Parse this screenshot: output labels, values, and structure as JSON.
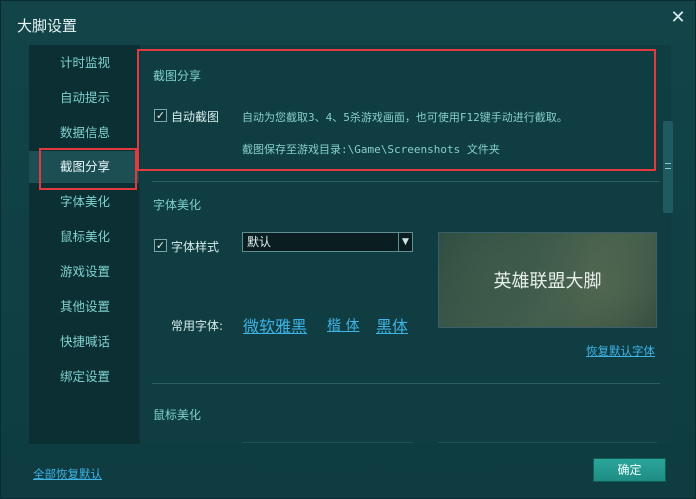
{
  "window": {
    "title": "大脚设置",
    "close_label": "✕"
  },
  "sidebar": {
    "items": [
      {
        "label": "计时监视"
      },
      {
        "label": "自动提示"
      },
      {
        "label": "数据信息"
      },
      {
        "label": "截图分享",
        "active": true
      },
      {
        "label": "字体美化"
      },
      {
        "label": "鼠标美化"
      },
      {
        "label": "游戏设置"
      },
      {
        "label": "其他设置"
      },
      {
        "label": "快捷喊话"
      },
      {
        "label": "绑定设置"
      }
    ]
  },
  "screenshot": {
    "title": "截图分享",
    "auto_checked": true,
    "auto_label": "自动截图",
    "desc_line1": "自动为您截取3、4、5杀游戏画面，也可使用F12键手动进行截取。",
    "desc_line2": "截图保存至游戏目录:\\Game\\Screenshots 文件夹"
  },
  "font": {
    "title": "字体美化",
    "style_checked": true,
    "style_label": "字体样式",
    "select_value": "默认",
    "preview_text": "英雄联盟大脚",
    "common_label": "常用字体:",
    "common_fonts": [
      "微软雅黑",
      "楷 体",
      "黑体"
    ],
    "restore_label": "恢复默认字体"
  },
  "mouse": {
    "title": "鼠标美化"
  },
  "footer": {
    "restore_all_label": "全部恢复默认",
    "ok_label": "确定"
  },
  "colors": {
    "highlight_border": "#e23a3f",
    "link": "#3fb2e6",
    "accent_button": "#1f8d84"
  }
}
